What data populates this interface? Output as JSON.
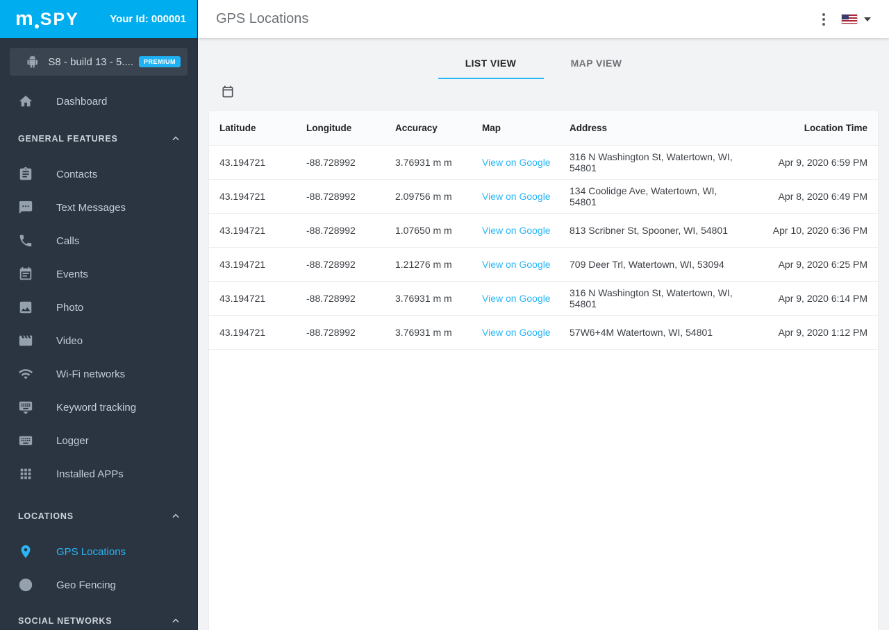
{
  "brand": {
    "logo_m": "m",
    "logo_rest": "SPY",
    "user_id": "Your Id: 000001"
  },
  "colors": {
    "accent": "#00aeef",
    "link_blue": "#29b6f6",
    "sidebar_bg": "#2b3541"
  },
  "sidebar": {
    "device": {
      "name": "S8 - build 13 - 5....",
      "badge": "PREMIUM",
      "icon": "android-icon"
    },
    "dashboard": {
      "label": "Dashboard",
      "icon": "home-icon"
    },
    "general": {
      "title": "GENERAL FEATURES",
      "items": [
        {
          "label": "Contacts",
          "icon": "contacts-icon"
        },
        {
          "label": "Text Messages",
          "icon": "chat-icon"
        },
        {
          "label": "Calls",
          "icon": "phone-icon"
        },
        {
          "label": "Events",
          "icon": "calendar-note-icon"
        },
        {
          "label": "Photo",
          "icon": "photo-icon"
        },
        {
          "label": "Video",
          "icon": "video-icon"
        },
        {
          "label": "Wi-Fi networks",
          "icon": "wifi-icon"
        },
        {
          "label": "Keyword tracking",
          "icon": "keyboard-tracking-icon"
        },
        {
          "label": "Logger",
          "icon": "keyboard-icon"
        },
        {
          "label": "Installed APPs",
          "icon": "apps-grid-icon"
        }
      ]
    },
    "locations": {
      "title": "LOCATIONS",
      "items": [
        {
          "label": "GPS Locations",
          "icon": "map-pin-icon",
          "active": true
        },
        {
          "label": "Geo Fencing",
          "icon": "geofence-icon",
          "active": false
        }
      ]
    },
    "social": {
      "title": "SOCIAL NETWORKS"
    }
  },
  "topbar": {
    "title": "GPS Locations"
  },
  "tabs": {
    "list": "LIST VIEW",
    "map": "MAP VIEW"
  },
  "table": {
    "columns": [
      "Latitude",
      "Longitude",
      "Accuracy",
      "Map",
      "Address",
      "Location Time"
    ],
    "rows": [
      {
        "latitude": "43.194721",
        "longitude": "-88.728992",
        "accuracy": "3.76931 m m",
        "map": "View on Google",
        "address": "316 N Washington St, Watertown, WI, 54801",
        "time": "Apr 9, 2020 6:59 PM"
      },
      {
        "latitude": "43.194721",
        "longitude": "-88.728992",
        "accuracy": "2.09756 m m",
        "map": "View on Google",
        "address": "134 Coolidge Ave, Watertown, WI, 54801",
        "time": "Apr 8, 2020 6:49 PM"
      },
      {
        "latitude": "43.194721",
        "longitude": "-88.728992",
        "accuracy": "1.07650 m m",
        "map": "View on Google",
        "address": "813 Scribner St, Spooner, WI, 54801",
        "time": "Apr 10, 2020 6:36 PM"
      },
      {
        "latitude": "43.194721",
        "longitude": "-88.728992",
        "accuracy": "1.21276 m m",
        "map": "View on Google",
        "address": "709 Deer Trl, Watertown, WI, 53094",
        "time": "Apr 9, 2020 6:25 PM"
      },
      {
        "latitude": "43.194721",
        "longitude": "-88.728992",
        "accuracy": "3.76931 m m",
        "map": "View on Google",
        "address": "316 N Washington St, Watertown, WI, 54801",
        "time": "Apr 9, 2020 6:14 PM"
      },
      {
        "latitude": "43.194721",
        "longitude": "-88.728992",
        "accuracy": "3.76931 m m",
        "map": "View on Google",
        "address": "57W6+4M Watertown, WI, 54801",
        "time": "Apr 9, 2020 1:12 PM"
      }
    ]
  }
}
